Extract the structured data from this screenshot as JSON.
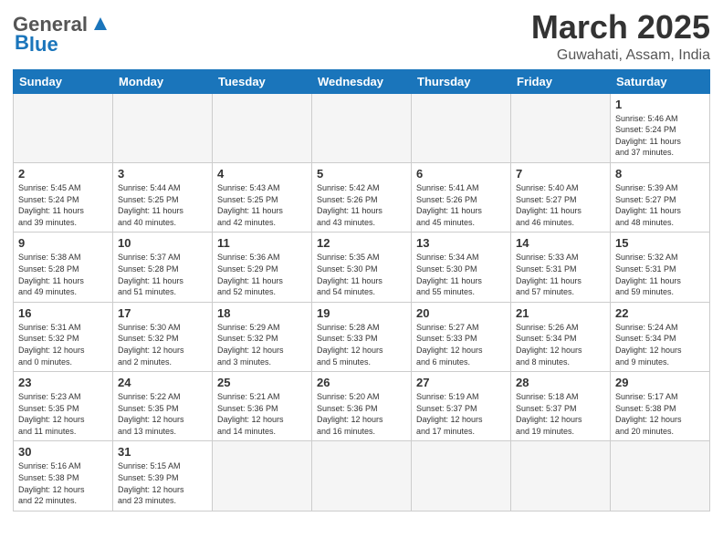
{
  "header": {
    "logo_general": "General",
    "logo_blue": "Blue",
    "month": "March 2025",
    "location": "Guwahati, Assam, India"
  },
  "weekdays": [
    "Sunday",
    "Monday",
    "Tuesday",
    "Wednesday",
    "Thursday",
    "Friday",
    "Saturday"
  ],
  "weeks": [
    [
      {
        "day": "",
        "info": ""
      },
      {
        "day": "",
        "info": ""
      },
      {
        "day": "",
        "info": ""
      },
      {
        "day": "",
        "info": ""
      },
      {
        "day": "",
        "info": ""
      },
      {
        "day": "",
        "info": ""
      },
      {
        "day": "1",
        "info": "Sunrise: 5:46 AM\nSunset: 5:24 PM\nDaylight: 11 hours\nand 37 minutes."
      }
    ],
    [
      {
        "day": "2",
        "info": "Sunrise: 5:45 AM\nSunset: 5:24 PM\nDaylight: 11 hours\nand 39 minutes."
      },
      {
        "day": "3",
        "info": "Sunrise: 5:44 AM\nSunset: 5:25 PM\nDaylight: 11 hours\nand 40 minutes."
      },
      {
        "day": "4",
        "info": "Sunrise: 5:43 AM\nSunset: 5:25 PM\nDaylight: 11 hours\nand 42 minutes."
      },
      {
        "day": "5",
        "info": "Sunrise: 5:42 AM\nSunset: 5:26 PM\nDaylight: 11 hours\nand 43 minutes."
      },
      {
        "day": "6",
        "info": "Sunrise: 5:41 AM\nSunset: 5:26 PM\nDaylight: 11 hours\nand 45 minutes."
      },
      {
        "day": "7",
        "info": "Sunrise: 5:40 AM\nSunset: 5:27 PM\nDaylight: 11 hours\nand 46 minutes."
      },
      {
        "day": "8",
        "info": "Sunrise: 5:39 AM\nSunset: 5:27 PM\nDaylight: 11 hours\nand 48 minutes."
      }
    ],
    [
      {
        "day": "9",
        "info": "Sunrise: 5:38 AM\nSunset: 5:28 PM\nDaylight: 11 hours\nand 49 minutes."
      },
      {
        "day": "10",
        "info": "Sunrise: 5:37 AM\nSunset: 5:28 PM\nDaylight: 11 hours\nand 51 minutes."
      },
      {
        "day": "11",
        "info": "Sunrise: 5:36 AM\nSunset: 5:29 PM\nDaylight: 11 hours\nand 52 minutes."
      },
      {
        "day": "12",
        "info": "Sunrise: 5:35 AM\nSunset: 5:30 PM\nDaylight: 11 hours\nand 54 minutes."
      },
      {
        "day": "13",
        "info": "Sunrise: 5:34 AM\nSunset: 5:30 PM\nDaylight: 11 hours\nand 55 minutes."
      },
      {
        "day": "14",
        "info": "Sunrise: 5:33 AM\nSunset: 5:31 PM\nDaylight: 11 hours\nand 57 minutes."
      },
      {
        "day": "15",
        "info": "Sunrise: 5:32 AM\nSunset: 5:31 PM\nDaylight: 11 hours\nand 59 minutes."
      }
    ],
    [
      {
        "day": "16",
        "info": "Sunrise: 5:31 AM\nSunset: 5:32 PM\nDaylight: 12 hours\nand 0 minutes."
      },
      {
        "day": "17",
        "info": "Sunrise: 5:30 AM\nSunset: 5:32 PM\nDaylight: 12 hours\nand 2 minutes."
      },
      {
        "day": "18",
        "info": "Sunrise: 5:29 AM\nSunset: 5:32 PM\nDaylight: 12 hours\nand 3 minutes."
      },
      {
        "day": "19",
        "info": "Sunrise: 5:28 AM\nSunset: 5:33 PM\nDaylight: 12 hours\nand 5 minutes."
      },
      {
        "day": "20",
        "info": "Sunrise: 5:27 AM\nSunset: 5:33 PM\nDaylight: 12 hours\nand 6 minutes."
      },
      {
        "day": "21",
        "info": "Sunrise: 5:26 AM\nSunset: 5:34 PM\nDaylight: 12 hours\nand 8 minutes."
      },
      {
        "day": "22",
        "info": "Sunrise: 5:24 AM\nSunset: 5:34 PM\nDaylight: 12 hours\nand 9 minutes."
      }
    ],
    [
      {
        "day": "23",
        "info": "Sunrise: 5:23 AM\nSunset: 5:35 PM\nDaylight: 12 hours\nand 11 minutes."
      },
      {
        "day": "24",
        "info": "Sunrise: 5:22 AM\nSunset: 5:35 PM\nDaylight: 12 hours\nand 13 minutes."
      },
      {
        "day": "25",
        "info": "Sunrise: 5:21 AM\nSunset: 5:36 PM\nDaylight: 12 hours\nand 14 minutes."
      },
      {
        "day": "26",
        "info": "Sunrise: 5:20 AM\nSunset: 5:36 PM\nDaylight: 12 hours\nand 16 minutes."
      },
      {
        "day": "27",
        "info": "Sunrise: 5:19 AM\nSunset: 5:37 PM\nDaylight: 12 hours\nand 17 minutes."
      },
      {
        "day": "28",
        "info": "Sunrise: 5:18 AM\nSunset: 5:37 PM\nDaylight: 12 hours\nand 19 minutes."
      },
      {
        "day": "29",
        "info": "Sunrise: 5:17 AM\nSunset: 5:38 PM\nDaylight: 12 hours\nand 20 minutes."
      }
    ],
    [
      {
        "day": "30",
        "info": "Sunrise: 5:16 AM\nSunset: 5:38 PM\nDaylight: 12 hours\nand 22 minutes."
      },
      {
        "day": "31",
        "info": "Sunrise: 5:15 AM\nSunset: 5:39 PM\nDaylight: 12 hours\nand 23 minutes."
      },
      {
        "day": "",
        "info": ""
      },
      {
        "day": "",
        "info": ""
      },
      {
        "day": "",
        "info": ""
      },
      {
        "day": "",
        "info": ""
      },
      {
        "day": "",
        "info": ""
      }
    ]
  ]
}
